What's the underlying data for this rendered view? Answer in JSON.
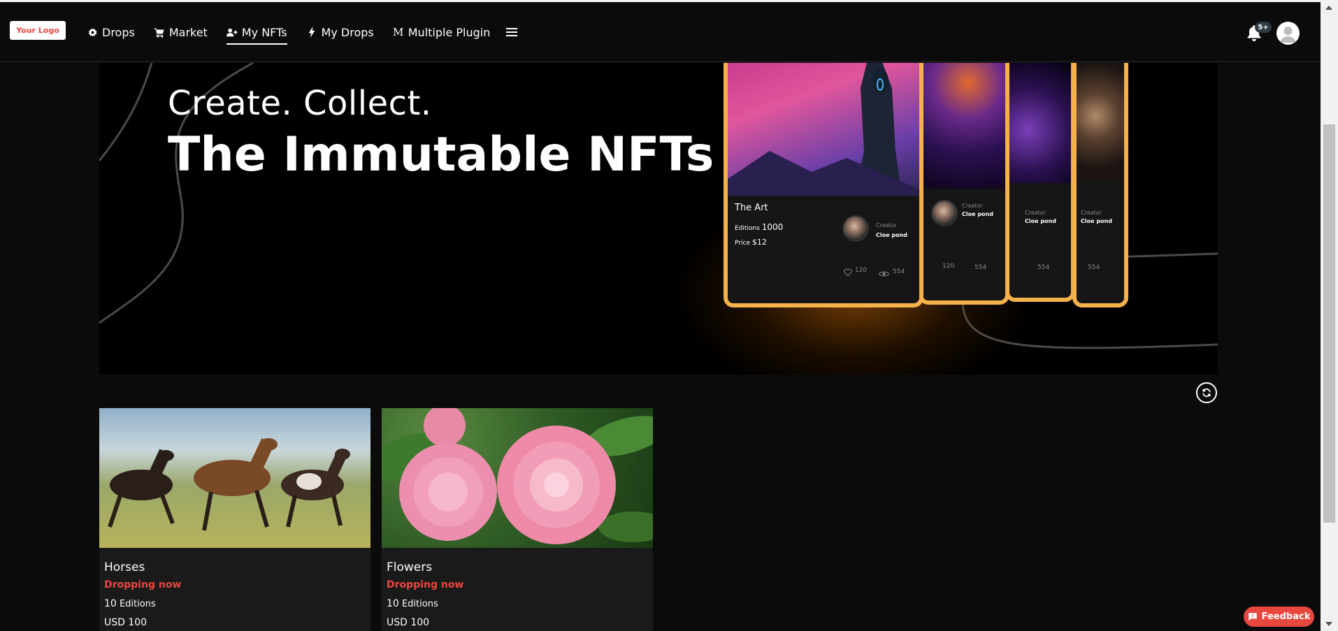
{
  "header": {
    "logo_text": "Your Logo",
    "nav": [
      {
        "label": "Drops",
        "icon": "gear-icon"
      },
      {
        "label": "Market",
        "icon": "cart-icon"
      },
      {
        "label": "My NFTs",
        "icon": "user-plus-icon",
        "active": true
      },
      {
        "label": "My Drops",
        "icon": "bolt-icon"
      },
      {
        "label": "Multiple Plugin",
        "icon": "m-icon",
        "icon_glyph": "M"
      }
    ],
    "notifications_badge": "5+"
  },
  "hero": {
    "line1": "Create. Collect.",
    "line2": "The Immutable NFTs",
    "card": {
      "title": "The Art",
      "editions_label": "Editions",
      "editions_value": "1000",
      "price_label": "Price",
      "price_value": "$12",
      "creator_label": "Creator",
      "creator_name": "Cloe pond",
      "likes": "120",
      "views": "554"
    }
  },
  "drops": [
    {
      "title": "Horses",
      "status": "Dropping now",
      "editions_count": "10",
      "editions_label": "Editions",
      "price": "USD 100"
    },
    {
      "title": "Flowers",
      "status": "Dropping now",
      "editions_count": "10",
      "editions_label": "Editions",
      "price": "USD 100"
    }
  ],
  "feedback_label": "Feedback",
  "colors": {
    "accent": "#e8473e",
    "card_border": "#f5b14a",
    "background": "#0b0b0b"
  }
}
